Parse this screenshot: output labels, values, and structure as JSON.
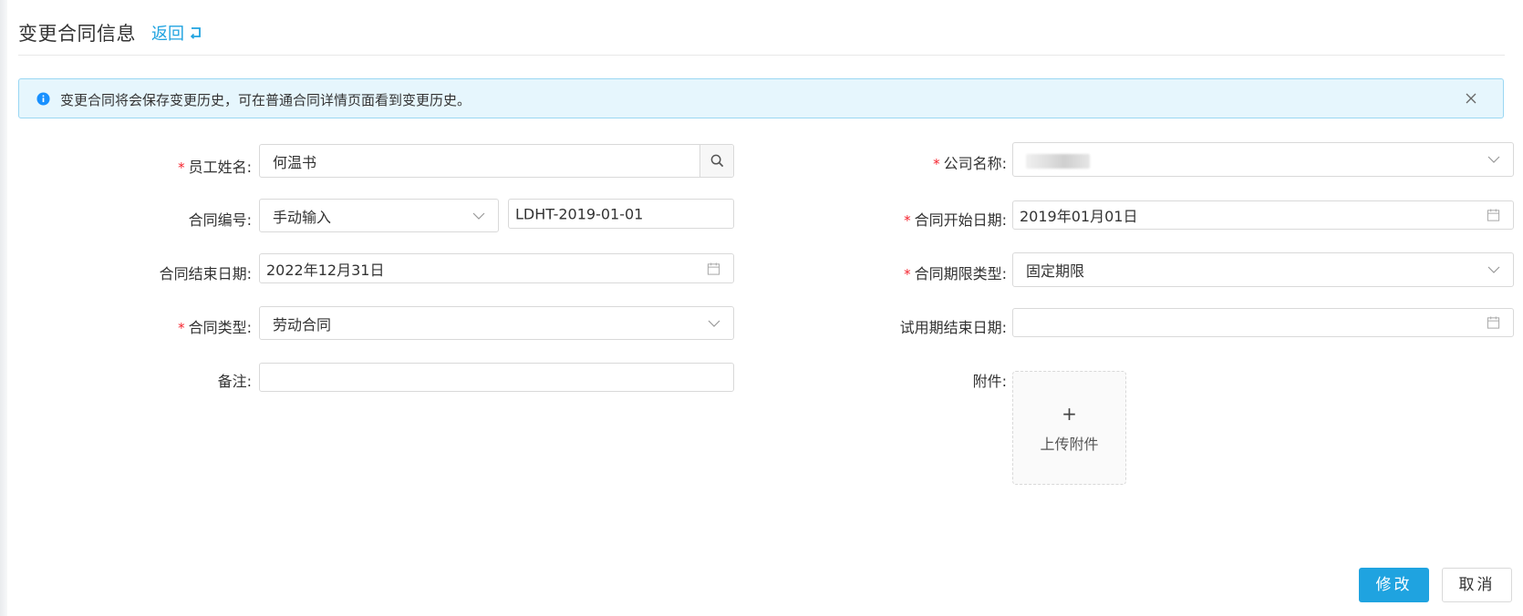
{
  "header": {
    "title": "变更合同信息",
    "back_label": "返回"
  },
  "alert": {
    "message": "变更合同将会保存变更历史，可在普通合同详情页面看到变更历史。"
  },
  "form": {
    "required_mark": "*",
    "employee_name": {
      "label": "员工姓名:",
      "value": "何温书",
      "required": true
    },
    "company_name": {
      "label": "公司名称:",
      "value": "",
      "required": true
    },
    "contract_number": {
      "label": "合同编号:",
      "mode": "手动输入",
      "value": "LDHT-2019-01-01",
      "required": false
    },
    "start_date": {
      "label": "合同开始日期:",
      "value": "2019年01月01日",
      "required": true
    },
    "end_date": {
      "label": "合同结束日期:",
      "value": "2022年12月31日",
      "required": false
    },
    "term_type": {
      "label": "合同期限类型:",
      "value": "固定期限",
      "required": true
    },
    "contract_type": {
      "label": "合同类型:",
      "value": "劳动合同",
      "required": true
    },
    "probation_end": {
      "label": "试用期结束日期:",
      "value": "",
      "required": false
    },
    "remark": {
      "label": "备注:",
      "value": "",
      "required": false
    },
    "attachment": {
      "label": "附件:",
      "plus": "+",
      "upload_label": "上传附件"
    }
  },
  "actions": {
    "submit_label": "修改",
    "cancel_label": "取消"
  },
  "colors": {
    "accent": "#1fa3e0",
    "required": "#f5222d",
    "alert_bg": "#e6f6fd",
    "alert_border": "#9ad7f3"
  }
}
